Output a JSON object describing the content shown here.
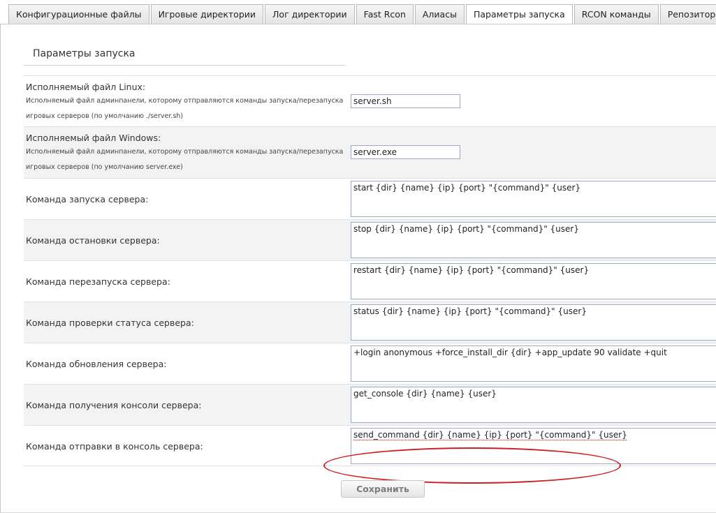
{
  "tabs": [
    {
      "label": "Конфигурационные файлы"
    },
    {
      "label": "Игровые директории"
    },
    {
      "label": "Лог директории"
    },
    {
      "label": "Fast Rcon"
    },
    {
      "label": "Алиасы"
    },
    {
      "label": "Параметры запуска",
      "active": true
    },
    {
      "label": "RCON команды"
    },
    {
      "label": "Репозитории"
    }
  ],
  "section": {
    "title": "Параметры запуска"
  },
  "fields": {
    "linux": {
      "label": "Исполняемый файл Linux:",
      "desc": "Исполняемый файл админпанели, которому отправляются команды запуска/перезапуска игровых серверов (по умолчанию ./server.sh)",
      "value": "server.sh"
    },
    "windows": {
      "label": "Исполняемый файл Windows:",
      "desc": "Исполняемый файл админпанели, которому отправляются команды запуска/перезапуска игровых серверов (по умолчанию server.exe)",
      "value": "server.exe"
    },
    "start": {
      "label": "Команда запуска сервера:",
      "value": "start {dir} {name} {ip} {port} \"{command}\" {user}"
    },
    "stop": {
      "label": "Команда остановки сервера:",
      "value": "stop {dir} {name} {ip} {port} \"{command}\" {user}"
    },
    "restart": {
      "label": "Команда перезапуска сервера:",
      "value": "restart {dir} {name} {ip} {port} \"{command}\" {user}"
    },
    "status": {
      "label": "Команда проверки статуса сервера:",
      "value": "status {dir} {name} {ip} {port} \"{command}\" {user}"
    },
    "update": {
      "label": "Команда обновления сервера:",
      "value": "+login anonymous +force_install_dir {dir} +app_update 90 validate +quit"
    },
    "console": {
      "label": "Команда получения консоли сервера:",
      "value": "get_console {dir} {name} {user}"
    },
    "send": {
      "label": "Команда отправки в консоль сервера:",
      "value": "send_command {dir} {name} {ip} {port} \"{command}\" {user}"
    }
  },
  "actions": {
    "save_label": "Сохранить"
  },
  "colors": {
    "highlight": "#cc1f1f",
    "row_alt": "#f3f3f3",
    "input_border": "#9aaac4"
  }
}
